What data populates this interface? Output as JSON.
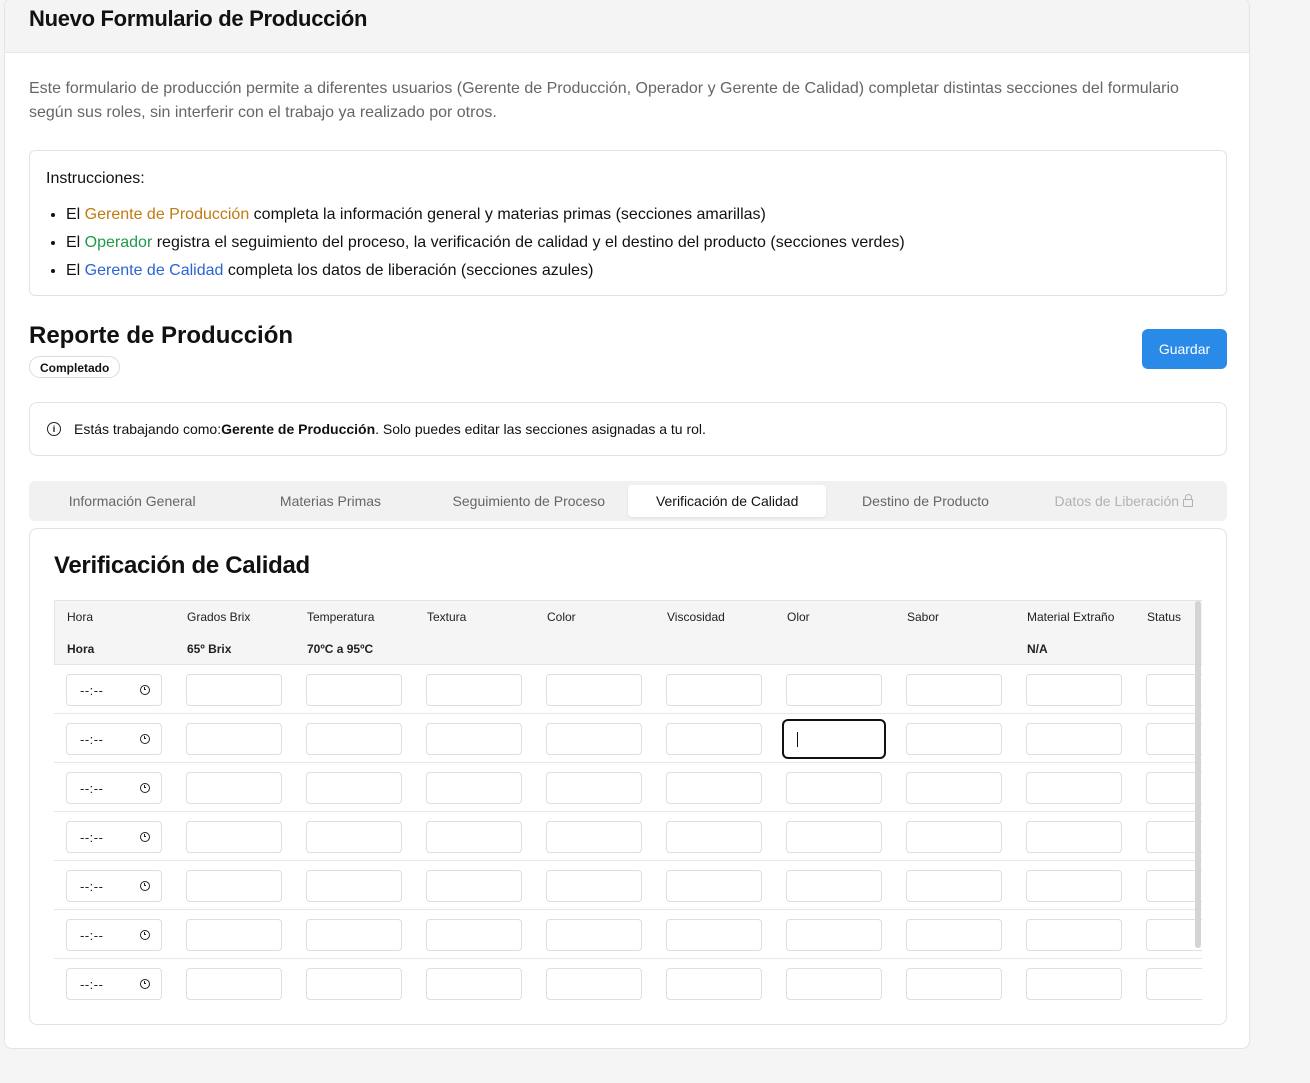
{
  "header": {
    "title": "Nuevo Formulario de Producción"
  },
  "description": "Este formulario de producción permite a diferentes usuarios (Gerente de Producción, Operador y Gerente de Calidad) completar distintas secciones del formulario según sus roles, sin interferir con el trabajo ya realizado por otros.",
  "instructions": {
    "title": "Instrucciones:",
    "items": [
      {
        "prefix": "El ",
        "role": "Gerente de Producción",
        "text": " completa la información general y materias primas (secciones amarillas)",
        "color": "#c07a10"
      },
      {
        "prefix": "El ",
        "role": "Operador",
        "text": " registra el seguimiento del proceso, la verificación de calidad y el destino del producto (secciones verdes)",
        "color": "#1f9a4a"
      },
      {
        "prefix": "El ",
        "role": "Gerente de Calidad",
        "text": " completa los datos de liberación (secciones azules)",
        "color": "#2a63d6"
      }
    ]
  },
  "report": {
    "title": "Reporte de Producción",
    "status_badge": "Completado",
    "save_label": "Guardar"
  },
  "alert": {
    "prefix": "Estás trabajando como: ",
    "role": "Gerente de Producción",
    "suffix": ". Solo puedes editar las secciones asignadas a tu rol.",
    "icon": "info-icon"
  },
  "tabs": [
    {
      "label": "Información General",
      "state": "normal"
    },
    {
      "label": "Materias Primas",
      "state": "normal"
    },
    {
      "label": "Seguimiento de Proceso",
      "state": "normal"
    },
    {
      "label": "Verificación de Calidad",
      "state": "active"
    },
    {
      "label": "Destino de Producto",
      "state": "normal"
    },
    {
      "label": "Datos de Liberación",
      "state": "disabled",
      "icon": "lock-icon"
    }
  ],
  "section": {
    "title": "Verificación de Calidad",
    "columns": [
      {
        "header": "Hora",
        "sub": "Hora"
      },
      {
        "header": "Grados Brix",
        "sub": "65º Brix"
      },
      {
        "header": "Temperatura",
        "sub": "70ºC a 95ºC"
      },
      {
        "header": "Textura",
        "sub": ""
      },
      {
        "header": "Color",
        "sub": ""
      },
      {
        "header": "Viscosidad",
        "sub": ""
      },
      {
        "header": "Olor",
        "sub": ""
      },
      {
        "header": "Sabor",
        "sub": ""
      },
      {
        "header": "Material Extraño",
        "sub": "N/A"
      },
      {
        "header": "Status",
        "sub": ""
      }
    ],
    "time_placeholder": "--:--",
    "row_count": 7,
    "focused_cell": {
      "row": 2,
      "column": "Olor"
    }
  },
  "colors": {
    "primary": "#2a8ae8",
    "produccion": "#c07a10",
    "operador": "#1f9a4a",
    "calidad": "#2a63d6"
  }
}
